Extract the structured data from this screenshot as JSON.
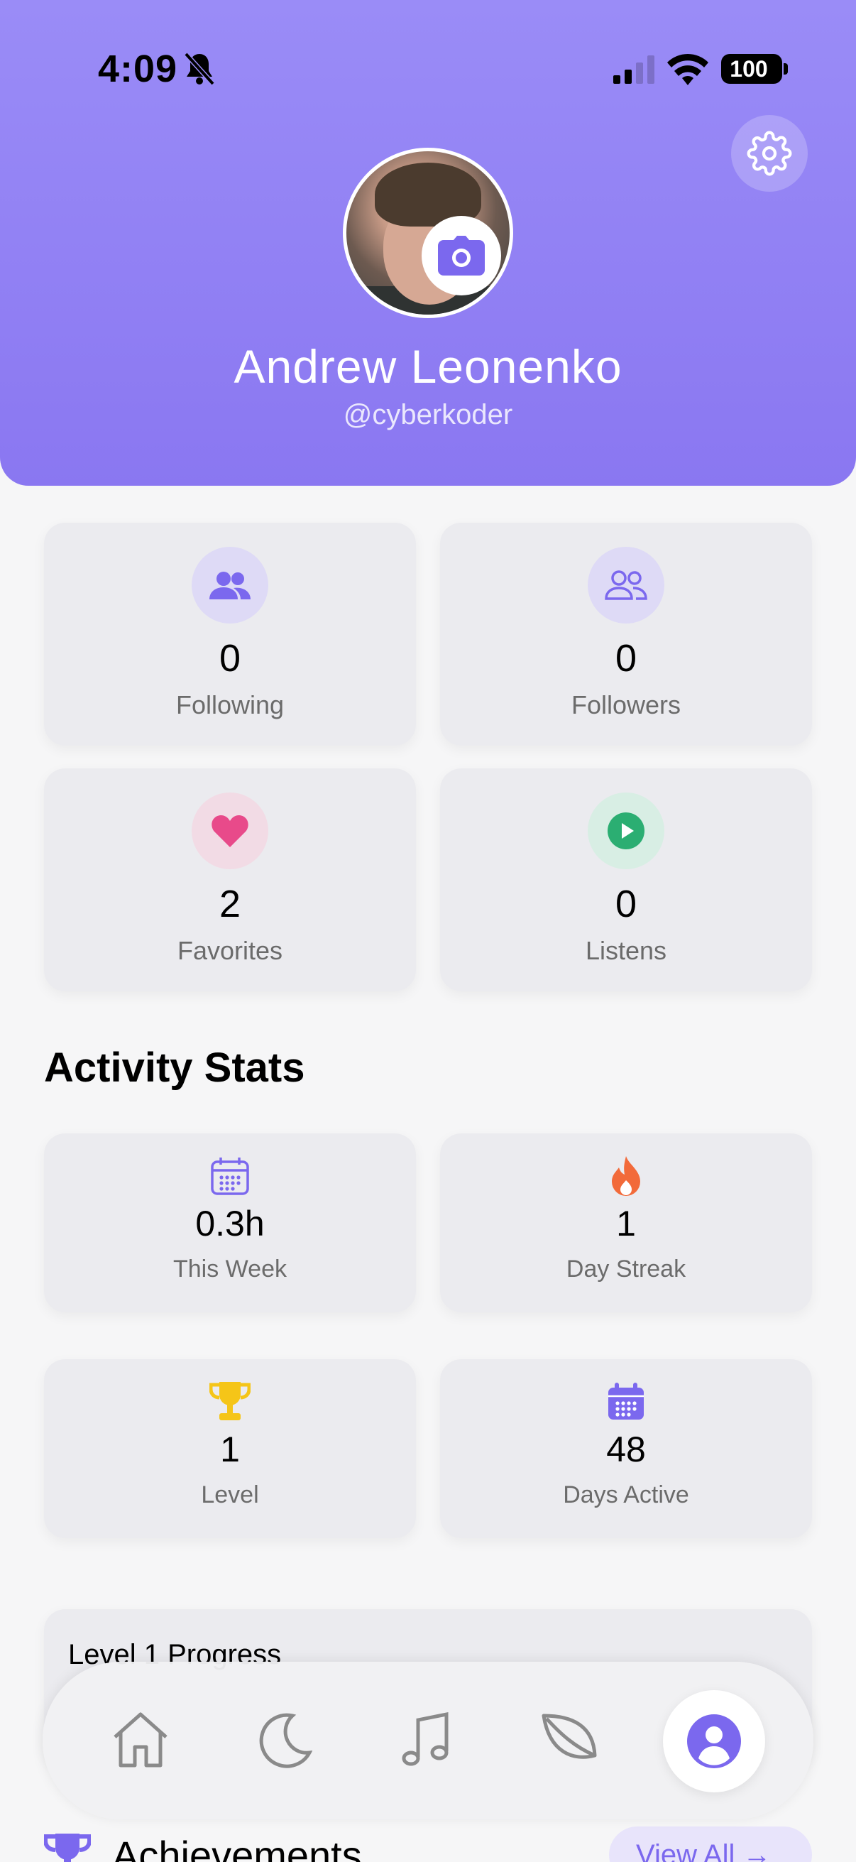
{
  "status_bar": {
    "time": "4:09",
    "battery": "100"
  },
  "profile": {
    "name": "Andrew Leonenko",
    "handle": "@cyberkoder"
  },
  "stats": [
    {
      "value": "0",
      "label": "Following",
      "icon": "users-icon",
      "color": "#7b68ee",
      "bg": "#dedaf6"
    },
    {
      "value": "0",
      "label": "Followers",
      "icon": "users-outline-icon",
      "color": "#7b68ee",
      "bg": "#dedaf6"
    },
    {
      "value": "2",
      "label": "Favorites",
      "icon": "heart-icon",
      "color": "#e84a8a",
      "bg": "#f2dbe5"
    },
    {
      "value": "0",
      "label": "Listens",
      "icon": "play-icon",
      "color": "#2bae72",
      "bg": "#d8eee4"
    }
  ],
  "activity_stats": {
    "title": "Activity Stats",
    "items": [
      {
        "value": "0.3h",
        "label": "This Week",
        "icon": "calendar-outline-icon",
        "color": "#7b68ee"
      },
      {
        "value": "1",
        "label": "Day Streak",
        "icon": "flame-icon",
        "color": "#f26a3a"
      },
      {
        "value": "1",
        "label": "Level",
        "icon": "trophy-icon",
        "color": "#f5c518"
      },
      {
        "value": "48",
        "label": "Days Active",
        "icon": "calendar-filled-icon",
        "color": "#7b68ee"
      }
    ]
  },
  "progress": {
    "title": "Level 1 Progress"
  },
  "achievements": {
    "title": "Achievements",
    "view_all": "View All →"
  },
  "nav": [
    "home-icon",
    "moon-icon",
    "music-note-icon",
    "leaf-icon",
    "profile-icon"
  ],
  "colors": {
    "accent": "#7b68ee",
    "header_top": "#9a8cf7",
    "header_bottom": "#8a77f1"
  }
}
